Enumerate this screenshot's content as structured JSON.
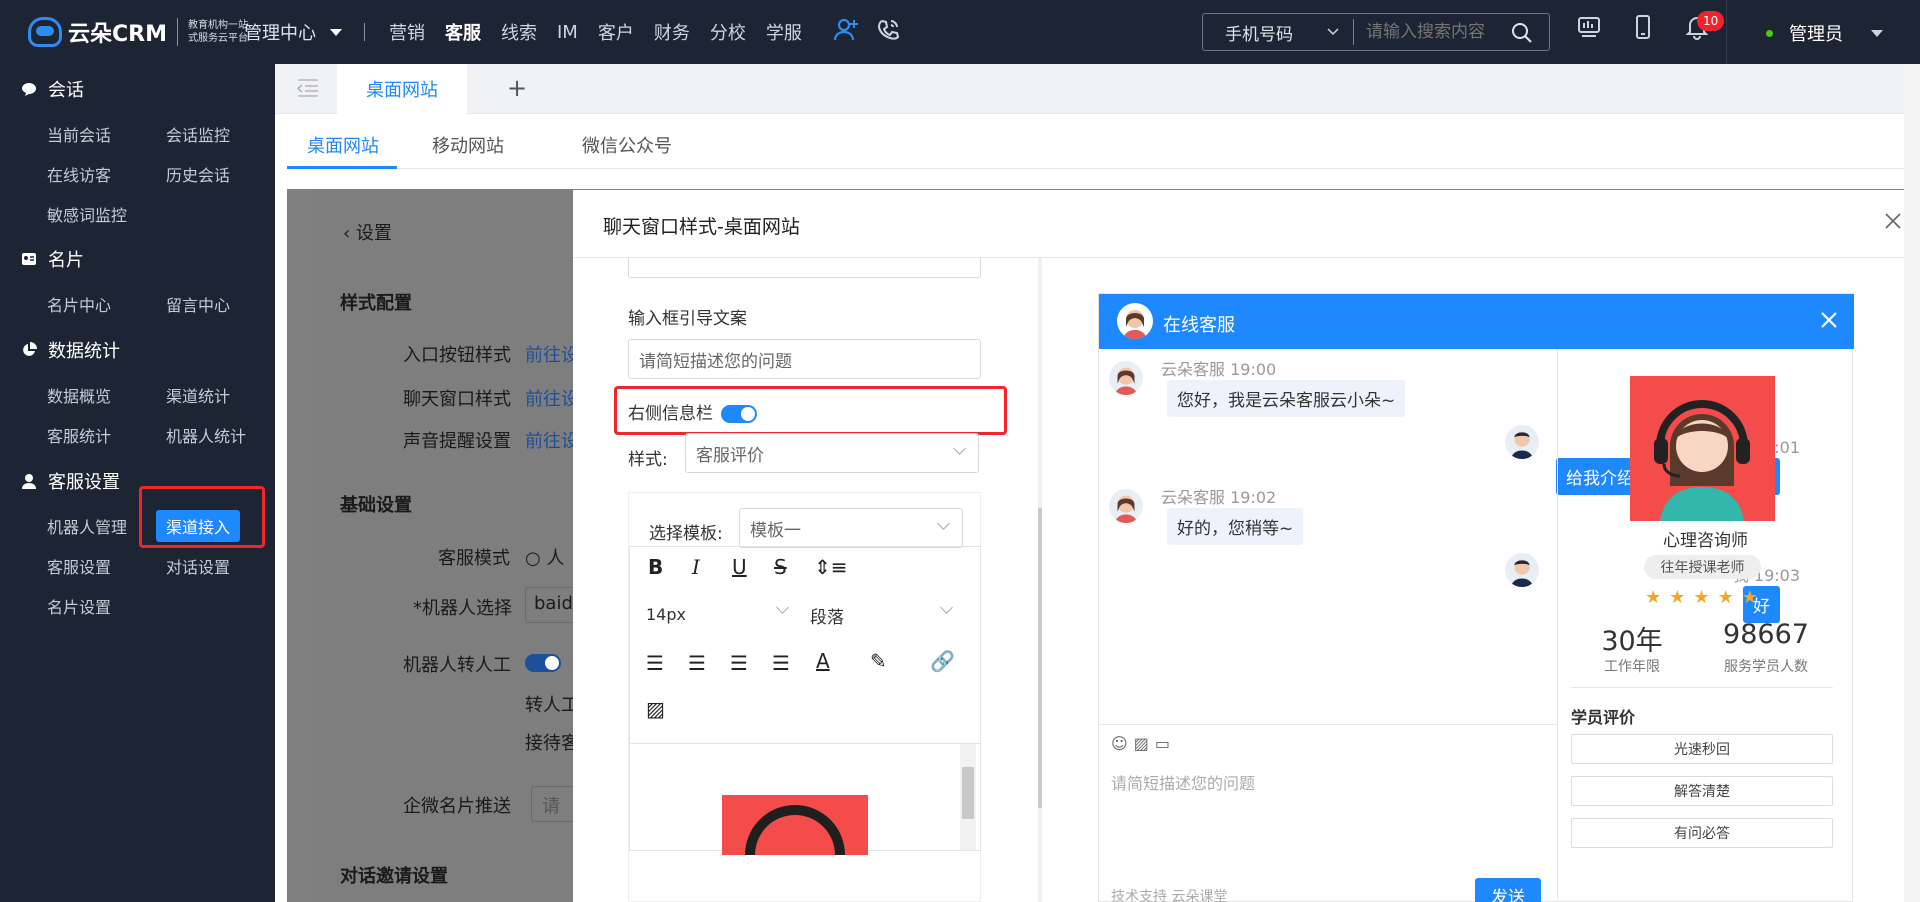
{
  "brand": {
    "name": "云朵CRM",
    "tagline1": "教育机构一站",
    "tagline2": "式服务云平台",
    "url": "www.yunduocrm.com"
  },
  "topnav": {
    "center": "管理中心",
    "items": [
      "营销",
      "客服",
      "线索",
      "IM",
      "客户",
      "财务",
      "分校",
      "学服"
    ],
    "active": "客服"
  },
  "search": {
    "type": "手机号码",
    "placeholder": "请输入搜索内容"
  },
  "notifications": {
    "count": "10"
  },
  "user": {
    "name": "管理员"
  },
  "sidebar": {
    "sections": [
      {
        "title": "会话",
        "icon": "chat-icon",
        "items": [
          "当前会话",
          "会话监控",
          "在线访客",
          "历史会话",
          "敏感词监控"
        ]
      },
      {
        "title": "名片",
        "icon": "card-icon",
        "items": [
          "名片中心",
          "留言中心"
        ]
      },
      {
        "title": "数据统计",
        "icon": "pie-chart-icon",
        "items": [
          "数据概览",
          "渠道统计",
          "客服统计",
          "机器人统计"
        ]
      },
      {
        "title": "客服设置",
        "icon": "agent-icon",
        "items": [
          "机器人管理",
          "渠道接入",
          "客服设置",
          "对话设置",
          "名片设置"
        ]
      }
    ],
    "active_item": "渠道接入"
  },
  "tabs": {
    "current": "桌面网站",
    "add": "+"
  },
  "subtabs": [
    "桌面网站",
    "移动网站",
    "微信公众号"
  ],
  "background": {
    "back": "设置",
    "style_config": "样式配置",
    "entry_style": "入口按钮样式",
    "chat_style": "聊天窗口样式",
    "sound": "声音提醒设置",
    "goto": "前往设",
    "basic": "基础设置",
    "mode": "客服模式",
    "mode_val": "人",
    "robot": "机器人选择",
    "robot_val": "baid",
    "robot_transfer": "机器人转人工",
    "transfer_text": "转人工",
    "reception": "接待客",
    "wecom": "企微名片推送",
    "wecom_val": "请",
    "invite": "对话邀请设置"
  },
  "modal": {
    "title": "聊天窗口样式-桌面网站",
    "input_guide_label": "输入框引导文案",
    "input_guide_value": "请简短描述您的问题",
    "right_panel_label": "右侧信息栏",
    "right_panel_on": true,
    "style_label": "样式:",
    "style_value": "客服评价",
    "template_label": "选择模板:",
    "template_value": "模板一",
    "editor": {
      "font_size": "14px",
      "paragraph": "段落"
    }
  },
  "preview": {
    "title": "在线客服",
    "messages": [
      {
        "from": "agent",
        "meta": "云朵客服 19:00",
        "text": "您好，我是云朵客服云小朵~"
      },
      {
        "from": "me",
        "meta": "我 19:01",
        "text": "给我介绍一下你们的产品吧"
      },
      {
        "from": "agent",
        "meta": "云朵客服 19:02",
        "text": "好的，您稍等~"
      },
      {
        "from": "me",
        "meta": "我 19:03",
        "text": "好"
      }
    ],
    "input_placeholder": "请简短描述您的问题",
    "footer": "技术支持 云朵课堂",
    "send": "发送",
    "profile": {
      "role": "心理咨询师",
      "tag": "往年授课老师",
      "rating": 5,
      "stat1_value": "30年",
      "stat1_label": "工作年限",
      "stat2_value": "98667",
      "stat2_label": "服务学员人数",
      "eval_title": "学员评价",
      "evals": [
        "光速秒回",
        "解答清楚",
        "有问必答"
      ]
    }
  },
  "colors": {
    "primary": "#1e88ff",
    "sidebar": "#1d2433",
    "highlight": "#f0262a"
  }
}
